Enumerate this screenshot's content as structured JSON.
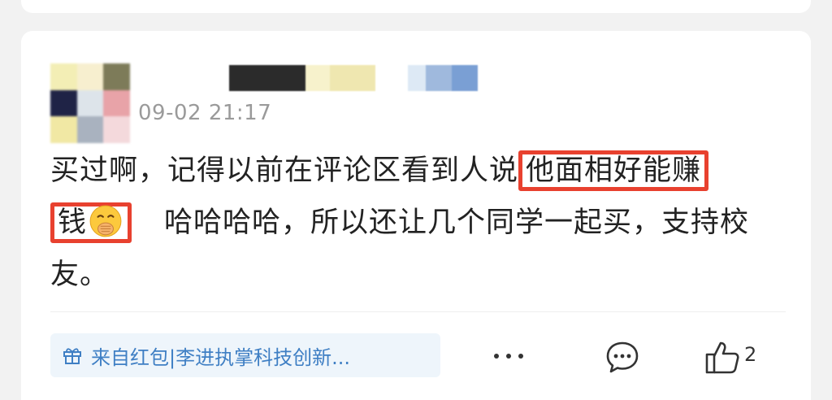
{
  "post": {
    "timestamp": "09-02 21:17",
    "avatar_pixels": [
      "#f3eeb5",
      "#f7efcf",
      "#7d7b59",
      "#1f2346",
      "#dde4ea",
      "#e8a3a8",
      "#f1e8a4",
      "#a9b2bf",
      "#f4d9dc"
    ],
    "nickname_blocks": [
      "#2b2b2b",
      "#f7f2cc",
      "#efe7b0",
      "#dde9f5",
      "#9fb9dd",
      "#7a9fd4"
    ],
    "comment": {
      "part1": "买过啊，记得以前在评论区看到人说",
      "highlight1": "他面相好能赚",
      "highlight2": "钱",
      "emoji_icon": "face-with-hand-over-mouth-emoji",
      "part2": "哈哈哈哈，所以还让几个同学一起买，支持校友。"
    },
    "source_tag": {
      "icon": "gift-icon",
      "label": "来自红包|李进执掌科技创新..."
    },
    "actions": {
      "more_icon": "more-dots-icon",
      "comment_icon": "comment-bubble-icon",
      "like_icon": "thumbs-up-icon",
      "like_count": "2"
    },
    "highlight_color": "#e8412f"
  }
}
